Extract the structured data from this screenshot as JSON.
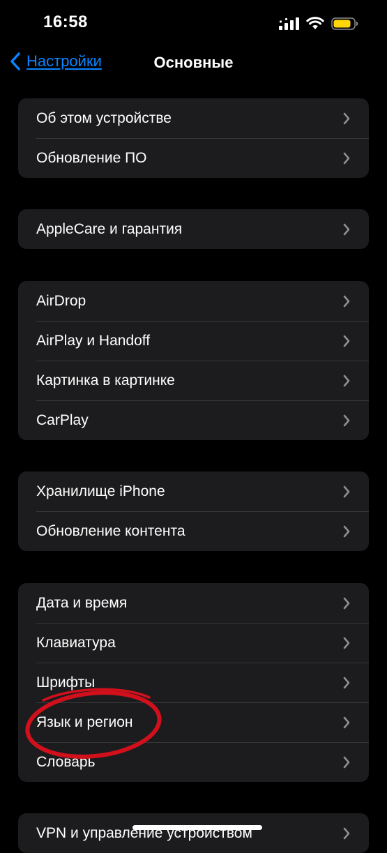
{
  "status_bar": {
    "time": "16:58",
    "icons": [
      "cellular-signal-icon",
      "wifi-icon",
      "battery-icon"
    ],
    "battery_color": "#ffd60a"
  },
  "nav": {
    "back_label": "Настройки",
    "title": "Основные",
    "accent": "#0a84ff"
  },
  "groups": [
    {
      "items": [
        "Об этом устройстве",
        "Обновление ПО"
      ]
    },
    {
      "items": [
        "AppleCare и гарантия"
      ]
    },
    {
      "items": [
        "AirDrop",
        "AirPlay и Handoff",
        "Картинка в картинке",
        "CarPlay"
      ]
    },
    {
      "items": [
        "Хранилище iPhone",
        "Обновление контента"
      ]
    },
    {
      "items": [
        "Дата и время",
        "Клавиатура",
        "Шрифты",
        "Язык и регион",
        "Словарь"
      ]
    },
    {
      "items": [
        "VPN и управление устройством"
      ]
    }
  ],
  "annotation": {
    "color": "#d1101c",
    "circled_item": "Язык и регион"
  }
}
